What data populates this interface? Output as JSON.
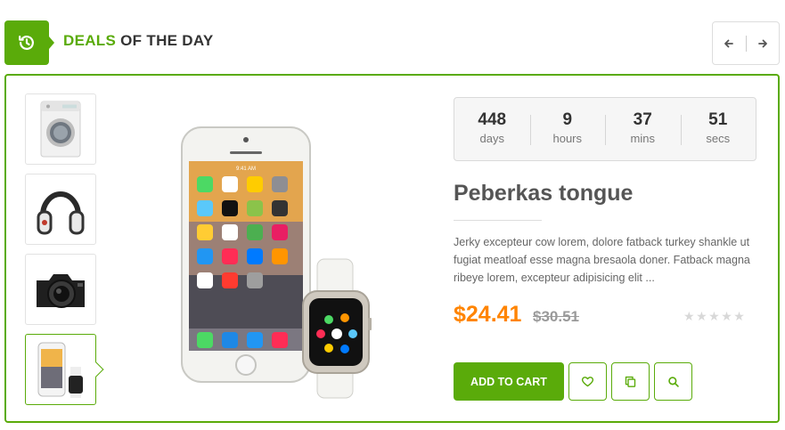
{
  "header": {
    "title_accent": "DEALS",
    "title_rest": "OF THE DAY",
    "icon": "history-icon"
  },
  "nav": {
    "prev_icon": "arrow-left-icon",
    "next_icon": "arrow-right-icon"
  },
  "thumbnails": [
    {
      "name": "washing machine",
      "active": false
    },
    {
      "name": "headphones",
      "active": false
    },
    {
      "name": "camera",
      "active": false
    },
    {
      "name": "phone and watch",
      "active": true
    }
  ],
  "phone": {
    "status_bar": "9:41 AM"
  },
  "countdown": [
    {
      "value": "448",
      "label": "days"
    },
    {
      "value": "9",
      "label": "hours"
    },
    {
      "value": "37",
      "label": "mins"
    },
    {
      "value": "51",
      "label": "secs"
    }
  ],
  "product": {
    "title": "Peberkas tongue",
    "description": " Jerky excepteur cow lorem, dolore fatback turkey shankle ut fugiat meatloaf esse magna bresaola doner. Fatback magna ribeye lorem, excepteur adipisicing elit ...",
    "price": "$24.41",
    "old_price": "$30.51",
    "rating": 0,
    "rating_max": 5
  },
  "actions": {
    "add_to_cart": "ADD TO CART",
    "wishlist_icon": "heart-icon",
    "compare_icon": "copy-icon",
    "quickview_icon": "search-icon"
  },
  "colors": {
    "accent": "#5aab0a",
    "price": "#ff8400"
  }
}
